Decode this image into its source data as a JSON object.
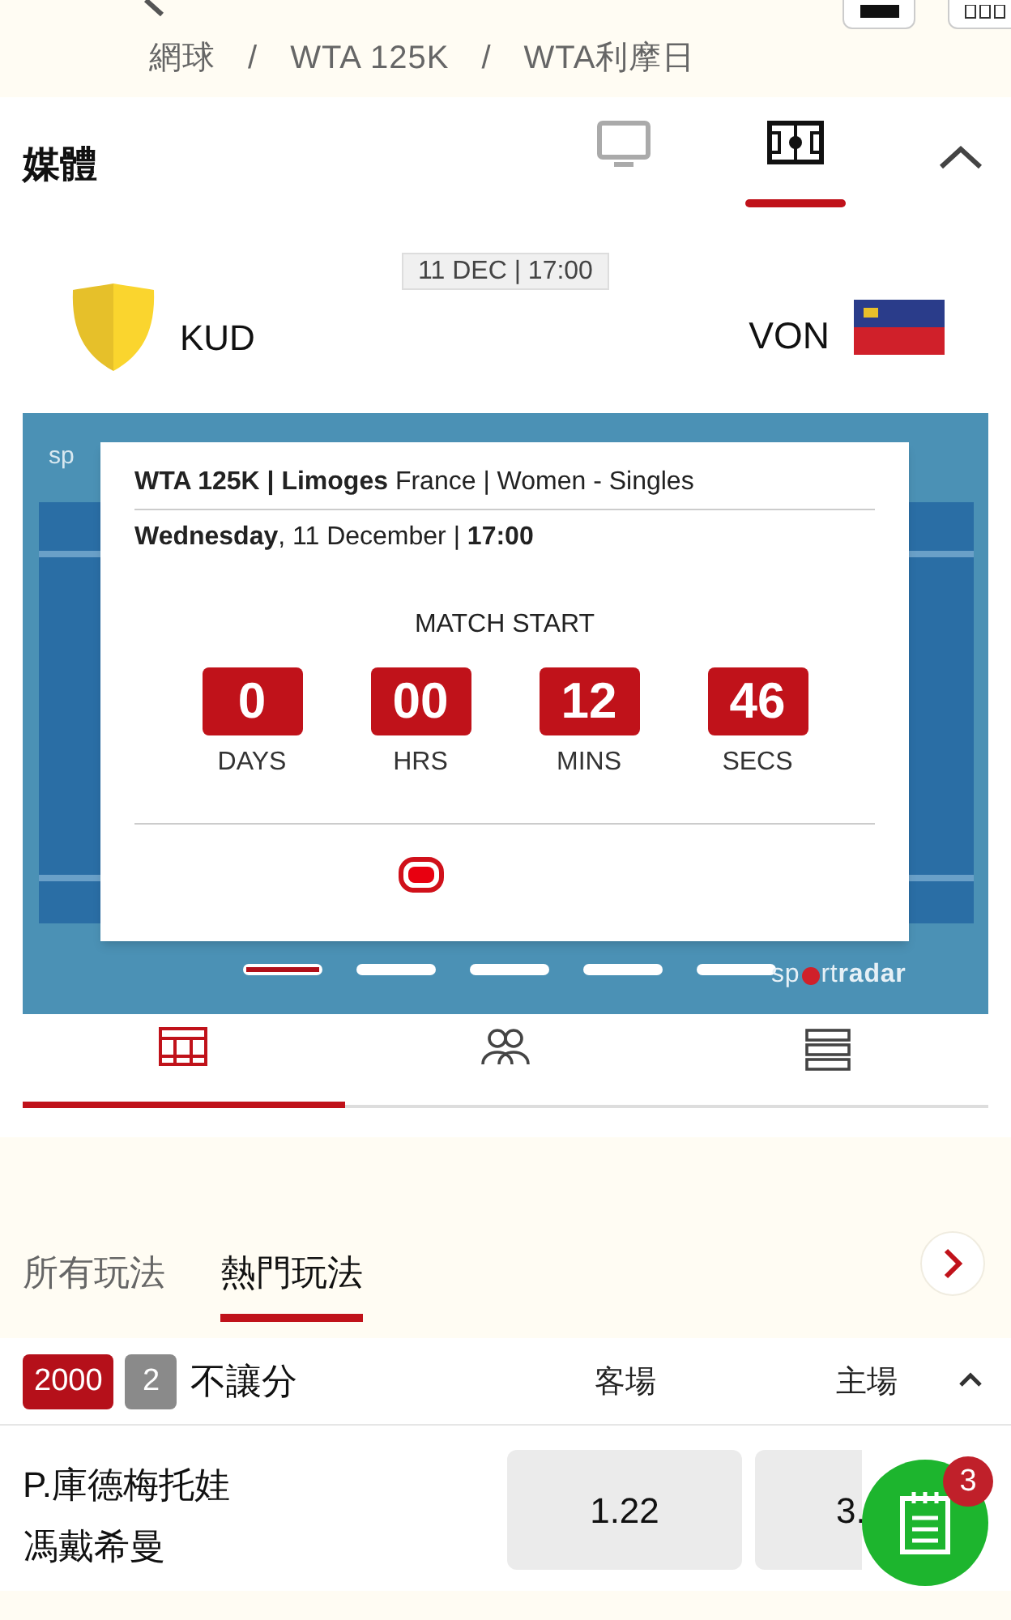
{
  "breadcrumb": [
    {
      "label": "網球",
      "separator": "/"
    },
    {
      "label": "WTA 125K",
      "separator": "/"
    },
    {
      "label": "WTA利摩日"
    }
  ],
  "media": {
    "title": "媒體",
    "tabs": [
      {
        "kind": "tv",
        "selected": false
      },
      {
        "kind": "field",
        "selected": true
      }
    ],
    "expanded": true
  },
  "match": {
    "date": "11 DEC | 17:00",
    "home": {
      "name": "KUD"
    },
    "away": {
      "name": "VON"
    }
  },
  "widget": {
    "logo_top": "sp",
    "info_line": "**WTA 125K | Limoges** France | Women - Singles",
    "date_line": "**Wednesday**, 11 December | **17:00**",
    "countdown_title": "MATCH START",
    "countdown": [
      {
        "value": "0",
        "unit": "DAYS"
      },
      {
        "value": "00",
        "unit": "HRS"
      },
      {
        "value": "12",
        "unit": "MINS"
      },
      {
        "value": "46",
        "unit": "SECS"
      }
    ],
    "pages": [
      {
        "selected": true
      },
      {
        "selected": false
      },
      {
        "selected": false
      },
      {
        "selected": false
      },
      {
        "selected": false
      }
    ],
    "logo": {
      "left": "sp",
      "right_light": "rt",
      "right_bold": "radar"
    }
  },
  "view_tabs": [
    {
      "kind": "court",
      "selected": true
    },
    {
      "kind": "lineups",
      "selected": false
    },
    {
      "kind": "list",
      "selected": false
    }
  ],
  "market_tabs": [
    {
      "label": "所有玩法",
      "selected": false
    },
    {
      "label": "熱門玩法",
      "selected": true
    }
  ],
  "market": {
    "code": "2000",
    "count": "2",
    "name": "不讓分",
    "columns": [
      "客場",
      "主場"
    ],
    "expanded": true,
    "rows": [
      {
        "away": "P.庫德梅托娃",
        "home": "馮戴希曼",
        "odds": [
          "1.22",
          "3."
        ]
      }
    ]
  },
  "betslip": {
    "count": "3"
  }
}
